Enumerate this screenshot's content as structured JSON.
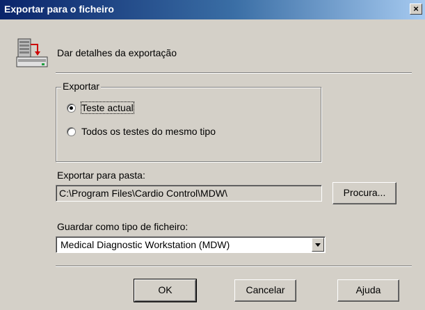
{
  "window": {
    "title": "Exportar para o ficheiro",
    "close_glyph": "×"
  },
  "header": {
    "icon": "database-export-icon",
    "text": "Dar detalhes da exportação"
  },
  "export_group": {
    "legend": "Exportar",
    "options": [
      {
        "label": "Teste actual",
        "checked": true
      },
      {
        "label": "Todos os testes do mesmo tipo",
        "checked": false
      }
    ]
  },
  "folder": {
    "label": "Exportar para pasta:",
    "value": "C:\\Program Files\\Cardio Control\\MDW\\",
    "browse_label": "Procura..."
  },
  "file_type": {
    "label": "Guardar como tipo de ficheiro:",
    "selected": "Medical Diagnostic Workstation (MDW)"
  },
  "buttons": {
    "ok": "OK",
    "cancel": "Cancelar",
    "help": "Ajuda"
  },
  "colors": {
    "title_start": "#0a246a",
    "title_end": "#a6caf0",
    "face": "#d4d0c8",
    "arrow_red": "#cc0000",
    "arrow_green": "#20a040"
  }
}
